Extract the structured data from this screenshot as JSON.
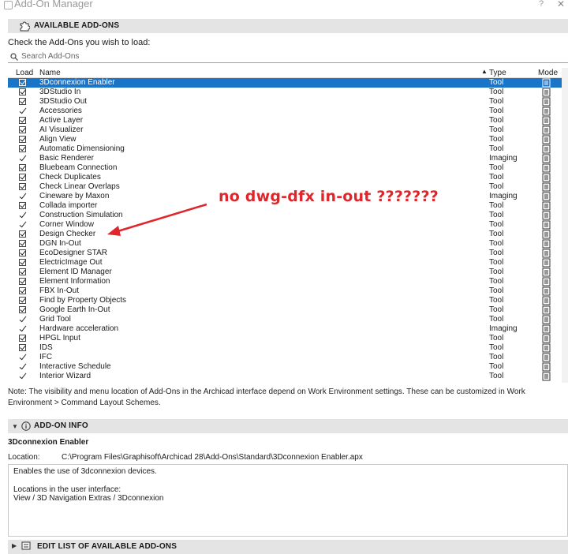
{
  "window": {
    "title": "Add-On Manager",
    "help": "?",
    "close": "✕"
  },
  "available": {
    "header": "AVAILABLE ADD-ONS",
    "instruction": "Check the Add-Ons you wish to load:",
    "search_placeholder": "Search Add-Ons",
    "columns": {
      "load": "Load",
      "name": "Name",
      "type": "Type",
      "mode": "Mode"
    },
    "rows": [
      {
        "name": "3Dconnexion Enabler",
        "type": "Tool",
        "load": "checkbox",
        "selected": true
      },
      {
        "name": "3DStudio In",
        "type": "Tool",
        "load": "checkbox"
      },
      {
        "name": "3DStudio Out",
        "type": "Tool",
        "load": "checkbox"
      },
      {
        "name": "Accessories",
        "type": "Tool",
        "load": "tick"
      },
      {
        "name": "Active Layer",
        "type": "Tool",
        "load": "checkbox"
      },
      {
        "name": "AI Visualizer",
        "type": "Tool",
        "load": "checkbox"
      },
      {
        "name": "Align View",
        "type": "Tool",
        "load": "checkbox"
      },
      {
        "name": "Automatic Dimensioning",
        "type": "Tool",
        "load": "checkbox"
      },
      {
        "name": "Basic Renderer",
        "type": "Imaging",
        "load": "tick"
      },
      {
        "name": "Bluebeam Connection",
        "type": "Tool",
        "load": "checkbox"
      },
      {
        "name": "Check Duplicates",
        "type": "Tool",
        "load": "checkbox"
      },
      {
        "name": "Check Linear Overlaps",
        "type": "Tool",
        "load": "checkbox"
      },
      {
        "name": "Cineware by Maxon",
        "type": "Imaging",
        "load": "tick"
      },
      {
        "name": "Collada importer",
        "type": "Tool",
        "load": "checkbox"
      },
      {
        "name": "Construction Simulation",
        "type": "Tool",
        "load": "tick"
      },
      {
        "name": "Corner Window",
        "type": "Tool",
        "load": "tick"
      },
      {
        "name": "Design Checker",
        "type": "Tool",
        "load": "checkbox"
      },
      {
        "name": "DGN In-Out",
        "type": "Tool",
        "load": "checkbox"
      },
      {
        "name": "EcoDesigner STAR",
        "type": "Tool",
        "load": "checkbox"
      },
      {
        "name": "ElectricImage Out",
        "type": "Tool",
        "load": "checkbox"
      },
      {
        "name": "Element ID Manager",
        "type": "Tool",
        "load": "checkbox"
      },
      {
        "name": "Element Information",
        "type": "Tool",
        "load": "checkbox"
      },
      {
        "name": "FBX In-Out",
        "type": "Tool",
        "load": "checkbox"
      },
      {
        "name": "Find by Property Objects",
        "type": "Tool",
        "load": "checkbox"
      },
      {
        "name": "Google Earth In-Out",
        "type": "Tool",
        "load": "checkbox"
      },
      {
        "name": "Grid Tool",
        "type": "Tool",
        "load": "tick"
      },
      {
        "name": "Hardware acceleration",
        "type": "Imaging",
        "load": "tick"
      },
      {
        "name": "HPGL Input",
        "type": "Tool",
        "load": "checkbox"
      },
      {
        "name": "IDS",
        "type": "Tool",
        "load": "checkbox"
      },
      {
        "name": "IFC",
        "type": "Tool",
        "load": "tick"
      },
      {
        "name": "Interactive Schedule",
        "type": "Tool",
        "load": "tick"
      },
      {
        "name": "Interior Wizard",
        "type": "Tool",
        "load": "tick"
      }
    ]
  },
  "note": "Note: The visibility and menu location of Add-Ons in the Archicad interface depend on Work Environment settings. These can be customized in Work Environment > Command Layout Schemes.",
  "info": {
    "header": "ADD-ON INFO",
    "name": "3Dconnexion Enabler",
    "location_label": "Location:",
    "location_value": "C:\\Program Files\\Graphisoft\\Archicad 28\\Add-Ons\\Standard\\3Dconnexion Enabler.apx",
    "description": "Enables the use of 3dconnexion devices.",
    "ui_label": "Locations in the user interface:",
    "ui_path": "View / 3D Navigation Extras / 3Dconnexion"
  },
  "edit": {
    "header": "EDIT LIST OF AVAILABLE ADD-ONS"
  },
  "annotation": {
    "text": "no dwg-dfx in-out  ???????",
    "color": "#e0252b"
  }
}
